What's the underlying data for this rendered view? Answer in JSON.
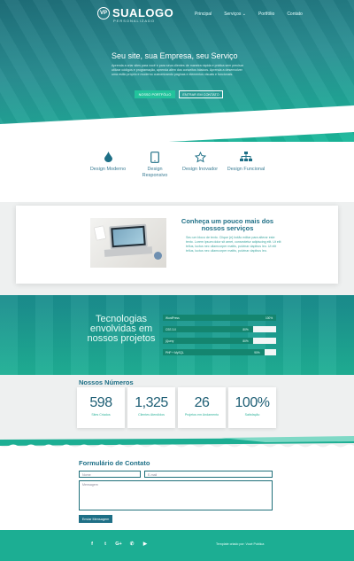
{
  "brand": {
    "name": "SUALOGO",
    "tagline": "PERSONALIZADO",
    "badge": "VP"
  },
  "nav": {
    "items": [
      "Principal",
      "Serviços",
      "Portfólio",
      "Contato"
    ]
  },
  "hero": {
    "title": "Seu site, sua Empresa, seu Serviço",
    "description": "Aprenda a criar sites para você e para seus clientes de maneira rápida e prática sem precisar utilizar códigos e programação, aprenda além dos conceitos básicos. Aprenda a desenvolver uma estilo próprio e moderno customizando páginas e elementos visuais e funcionais.",
    "primary_button": "NOSSO PORTFÓLIO",
    "secondary_button": "ENTRAR EM CONTATO"
  },
  "features": [
    {
      "label": "Design Moderno",
      "icon": "drop-icon"
    },
    {
      "label": "Design Responsivo",
      "icon": "tablet-icon"
    },
    {
      "label": "Design Inovador",
      "icon": "star-icon"
    },
    {
      "label": "Design Funcional",
      "icon": "sitemap-icon"
    }
  ],
  "about": {
    "title": "Conheça um pouco mais dos nossos serviços",
    "text": "Seu um bloco de texto. Clique {e} botão editar para alterar este texto. Lorem ipsum dolor sit amet, consectetur adipiscing elit. Ut elit tellus, luctus nec ullamcorper mattis, pulvinar dapibus leo. Ut elit tellus, luctus nec ullamcorper mattis, pulvinar dapibus leo."
  },
  "tech": {
    "title": "Tecnologias envolvidas em nossos projetos",
    "skills": [
      {
        "name": "WordPress",
        "percent": 100
      },
      {
        "name": "CSS 3.0",
        "percent": 80
      },
      {
        "name": "jQuery",
        "percent": 80
      },
      {
        "name": "PHP + MySQL",
        "percent": 90
      }
    ]
  },
  "numbers": {
    "title": "Nossos Números",
    "items": [
      {
        "value": "598",
        "caption": "Sites Criados"
      },
      {
        "value": "1,325",
        "caption": "Clientes Atendidos"
      },
      {
        "value": "26",
        "caption": "Projetos em Andamento"
      },
      {
        "value": "100%",
        "caption": "Satisfação"
      }
    ]
  },
  "contact": {
    "title": "Formulário de Contato",
    "name_placeholder": "Nome",
    "email_placeholder": "E-mail",
    "message_placeholder": "Mensagem",
    "send_button": "Enviar Mensagem"
  },
  "footer": {
    "social": [
      "facebook-icon",
      "twitter-icon",
      "google-plus-icon",
      "whatsapp-icon",
      "youtube-icon"
    ],
    "credits": "Template criado por: Vocé Publica"
  },
  "colors": {
    "primary": "#1e6f86",
    "accent": "#1cae93",
    "hero_dark": "#1f6f7a"
  }
}
